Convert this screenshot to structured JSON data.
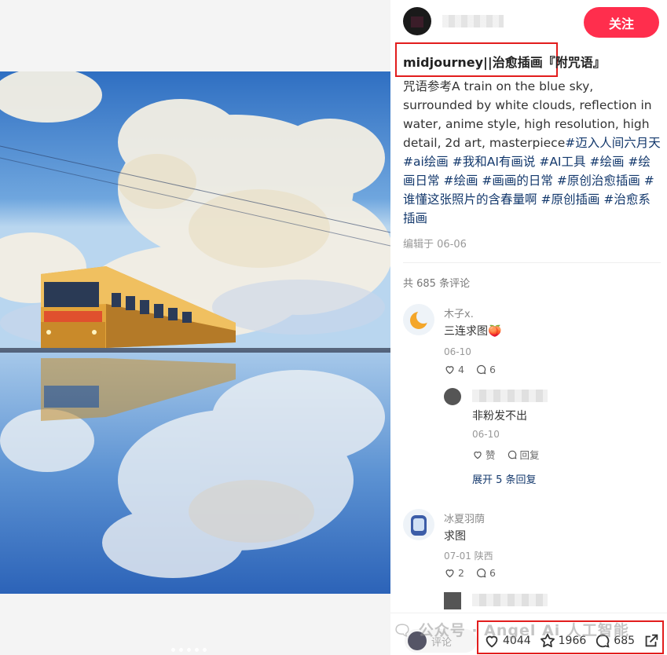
{
  "author": {
    "follow_label": "关注"
  },
  "post": {
    "title": "midjourney||治愈插画『附咒语』",
    "prompt": "咒语参考A train on the blue sky, surrounded by white clouds, reflection in water, anime style, high resolution, high detail, 2d art, masterpiece",
    "tags": [
      "#迈入人间六月天",
      "#ai绘画",
      "#我和AI有画说",
      "#AI工具",
      "#绘画",
      "#绘画日常",
      "#绘画",
      "#画画的日常",
      "#原创治愈插画",
      "#谁懂这张照片的含春量啊",
      "#原创插画",
      "#治愈系插画"
    ],
    "edited": "编辑于 06-06"
  },
  "comments_header": "共 685 条评论",
  "comments": [
    {
      "name": "木子x.",
      "text": "三连求图🍑",
      "date": "06-10",
      "likes": "4",
      "replies": "6"
    },
    {
      "name": "冰夏羽荫",
      "text": "求图",
      "date": "07-01 陕西",
      "likes": "2",
      "replies": "6"
    }
  ],
  "reply": {
    "text": "非粉发不出",
    "date": "06-10",
    "like_label": "赞",
    "reply_label": "回复",
    "expand_label": "展开 5 条回复"
  },
  "bottom": {
    "comment_placeholder": "评论",
    "likes": "4044",
    "stars": "1966",
    "comments": "685"
  },
  "watermark": "🗨 公众号 · Angel Ai 人工智能",
  "colors": {
    "accent": "#ff2e4d",
    "tag": "#13386c",
    "highlight_box": "#e21d1d"
  }
}
